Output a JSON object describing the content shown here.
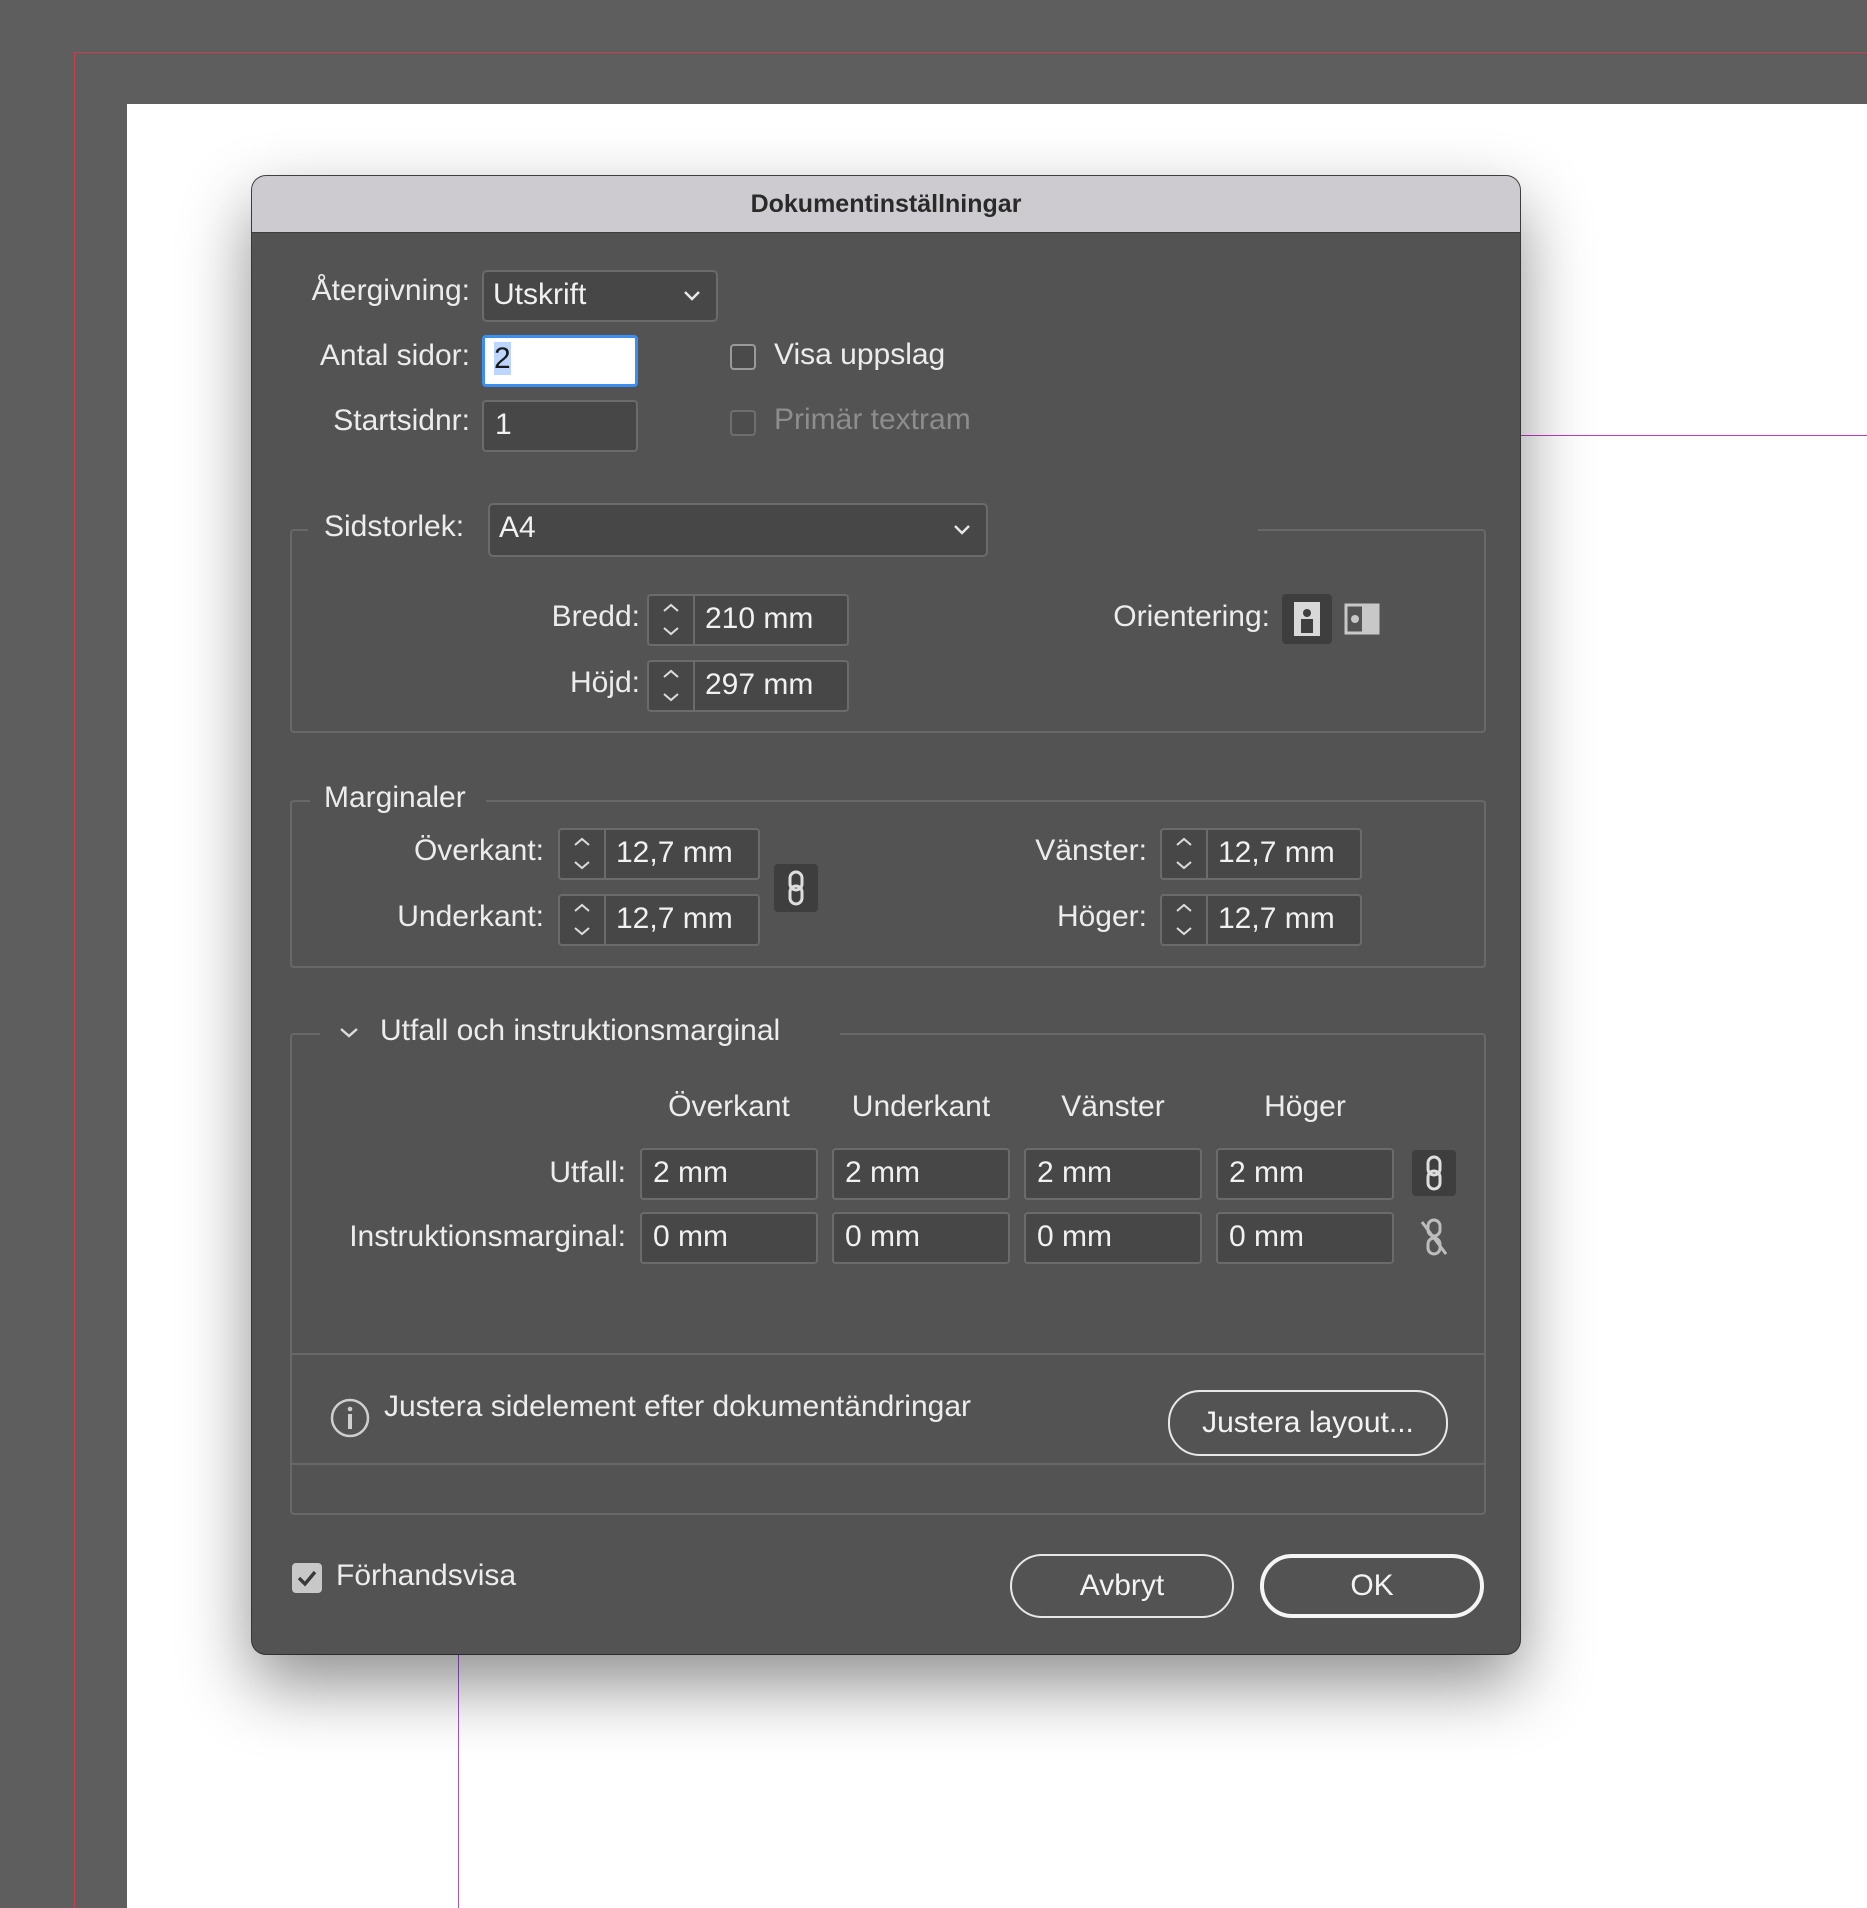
{
  "dialog": {
    "title": "Dokumentinställningar",
    "rendering": {
      "label": "Återgivning:",
      "value": "Utskrift"
    },
    "num_pages": {
      "label": "Antal sidor:",
      "value": "2"
    },
    "start_page": {
      "label": "Startsidnr:",
      "value": "1"
    },
    "facing_pages": {
      "label": "Visa uppslag",
      "checked": false
    },
    "primary_text_frame": {
      "label": "Primär textram",
      "checked": false,
      "disabled": true
    },
    "page_size": {
      "label": "Sidstorlek:",
      "value": "A4",
      "width": {
        "label": "Bredd:",
        "value": "210 mm"
      },
      "height": {
        "label": "Höjd:",
        "value": "297 mm"
      },
      "orientation": {
        "label": "Orientering:",
        "selected": "portrait"
      }
    },
    "margins": {
      "legend": "Marginaler",
      "top": {
        "label": "Överkant:",
        "value": "12,7 mm"
      },
      "bottom": {
        "label": "Underkant:",
        "value": "12,7 mm"
      },
      "left": {
        "label": "Vänster:",
        "value": "12,7 mm"
      },
      "right": {
        "label": "Höger:",
        "value": "12,7 mm"
      },
      "linked": true
    },
    "bleed_slug": {
      "legend": "Utfall och instruktionsmarginal",
      "columns": [
        "Överkant",
        "Underkant",
        "Vänster",
        "Höger"
      ],
      "bleed": {
        "label": "Utfall:",
        "values": [
          "2 mm",
          "2 mm",
          "2 mm",
          "2 mm"
        ],
        "linked": true
      },
      "slug": {
        "label": "Instruktionsmarginal:",
        "values": [
          "0 mm",
          "0 mm",
          "0 mm",
          "0 mm"
        ],
        "linked": false
      }
    },
    "adjust": {
      "info": "Justera sidelement efter dokumentändringar",
      "button": "Justera layout..."
    },
    "preview": {
      "label": "Förhandsvisa",
      "checked": true
    },
    "cancel": "Avbryt",
    "ok": "OK"
  }
}
